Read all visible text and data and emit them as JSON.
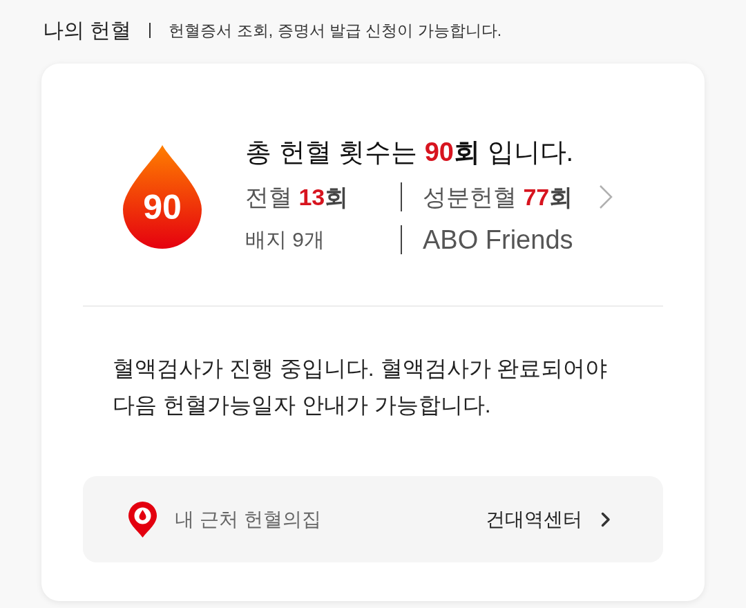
{
  "header": {
    "title": "나의 헌혈",
    "subtitle": "헌혈증서 조회, 증명서 발급 신청이 가능합니다."
  },
  "summary": {
    "drop_count": "90",
    "headline": {
      "before": "총 헌혈 횟수는 ",
      "count": "90",
      "unit": "회",
      "after": " 입니다."
    },
    "stats": [
      {
        "label": "전혈",
        "count": "13",
        "unit": "회"
      },
      {
        "label": "성분헌혈",
        "count": "77",
        "unit": "회"
      }
    ],
    "badges": "배지 9개",
    "club": "ABO Friends"
  },
  "notice": {
    "lines": [
      "혈액검사가 진행 중입니다. 혈액검사가 완료되어야",
      "다음 헌혈가능일자 안내가 가능합니다."
    ]
  },
  "nearby": {
    "label": "내 근처 헌혈의집",
    "center": "건대역센터"
  }
}
